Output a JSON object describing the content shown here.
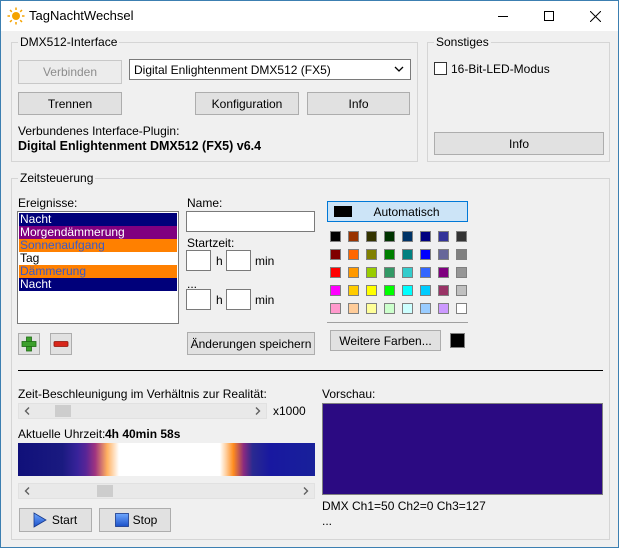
{
  "window": {
    "title": "TagNachtWechsel",
    "minimize": "—",
    "maximize": "☐",
    "close": "✕"
  },
  "dmx": {
    "legend": "DMX512-Interface",
    "connect_label": "Verbinden",
    "plugin_select": "Digital Enlightenment DMX512 (FX5)",
    "disconnect_label": "Trennen",
    "config_label": "Konfiguration",
    "info_label": "Info",
    "plugin_caption": "Verbundenes Interface-Plugin:",
    "plugin_name": "Digital Enlightenment DMX512 (FX5) v6.4"
  },
  "misc": {
    "legend": "Sonstiges",
    "checkbox_label": "16-Bit-LED-Modus",
    "info_label": "Info"
  },
  "timing": {
    "legend": "Zeitsteuerung",
    "events_label": "Ereignisse:",
    "events": [
      {
        "label": "Nacht",
        "bg": "#00007a",
        "fg": "#ffffff"
      },
      {
        "label": "Morgendämmerung",
        "bg": "#800080",
        "fg": "#ffffff"
      },
      {
        "label": "Sonnenaufgang",
        "bg": "#ff8000",
        "fg": "#3a5ac8"
      },
      {
        "label": "Tag",
        "bg": "#ffffff",
        "fg": "#000000"
      },
      {
        "label": "Dämmerung",
        "bg": "#ff8000",
        "fg": "#3a5ac8"
      },
      {
        "label": "Nacht",
        "bg": "#00007a",
        "fg": "#ffffff"
      }
    ],
    "name_label": "Name:",
    "start_label": "Startzeit:",
    "hour_unit": "h",
    "min_unit": "min",
    "ellipsis": "...",
    "save_label": "Änderungen speichern",
    "auto_label": "Automatisch",
    "more_colors_label": "Weitere Farben...",
    "palette": [
      "#000000",
      "#993300",
      "#333300",
      "#003300",
      "#003366",
      "#000080",
      "#333399",
      "#333333",
      "#800000",
      "#ff6600",
      "#808000",
      "#008000",
      "#008080",
      "#0000ff",
      "#666699",
      "#808080",
      "#ff0000",
      "#ff9900",
      "#99cc00",
      "#339966",
      "#33cccc",
      "#3366ff",
      "#800080",
      "#969696",
      "#ff00ff",
      "#ffcc00",
      "#ffff00",
      "#00ff00",
      "#00ffff",
      "#00ccff",
      "#993366",
      "#c0c0c0",
      "#ff99cc",
      "#ffcc99",
      "#ffff99",
      "#ccffcc",
      "#ccffff",
      "#99ccff",
      "#cc99ff",
      "#ffffff"
    ],
    "accel_label": "Zeit-Beschleunigung im Verhältnis zur Realität:",
    "accel_value": "x1000",
    "accel_fraction": 0.1,
    "time_label": "Aktuelle Uhrzeit:",
    "time_value": "4h 40min 58s",
    "time_fraction": 0.25,
    "start_btn": "Start",
    "stop_btn": "Stop",
    "preview_label": "Vorschau:",
    "preview_color": "#2b0a82",
    "dmx_readout": "DMX Ch1=50 Ch2=0 Ch3=127",
    "dmx_more": "..."
  }
}
